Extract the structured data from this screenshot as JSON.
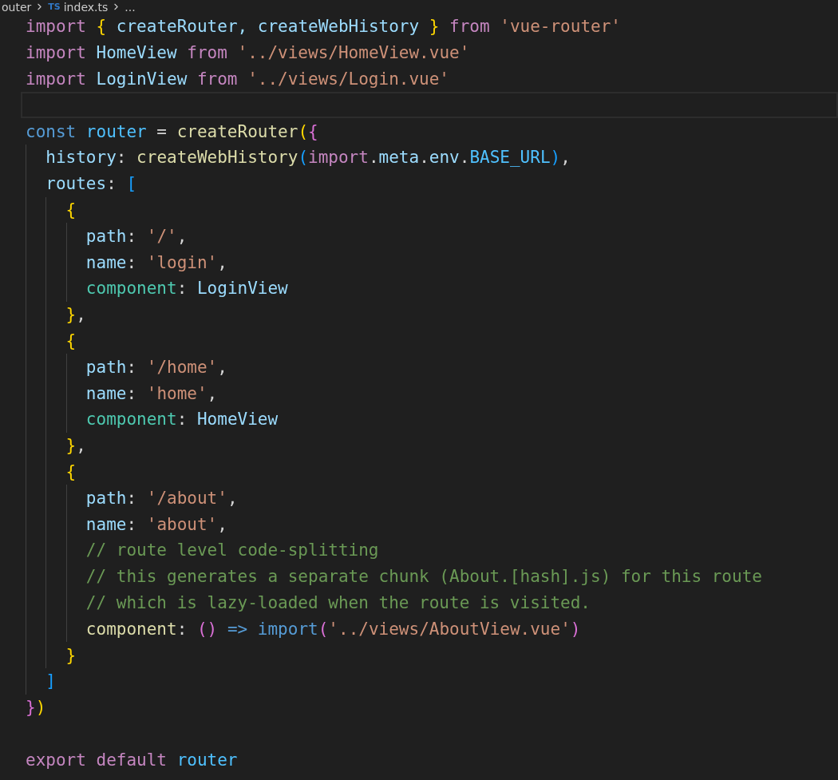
{
  "breadcrumb": {
    "folder": "outer",
    "file_badge": "TS",
    "file": "index.ts",
    "more": "..."
  },
  "lines": [
    {
      "active": false,
      "tokens": [
        {
          "text": "import ",
          "kind": "keyword"
        },
        {
          "text": "{",
          "kind": "bracket1"
        },
        {
          "text": " createRouter, createWebHistory ",
          "kind": "variable"
        },
        {
          "text": "}",
          "kind": "bracket1"
        },
        {
          "text": " from ",
          "kind": "keyword"
        },
        {
          "text": "'vue-router'",
          "kind": "string"
        }
      ]
    },
    {
      "active": false,
      "tokens": [
        {
          "text": "import",
          "kind": "keyword"
        },
        {
          "text": " HomeView ",
          "kind": "variable"
        },
        {
          "text": "from ",
          "kind": "keyword"
        },
        {
          "text": "'../views/HomeView.vue'",
          "kind": "string"
        }
      ]
    },
    {
      "active": false,
      "tokens": [
        {
          "text": "import",
          "kind": "keyword"
        },
        {
          "text": " LoginView ",
          "kind": "variable"
        },
        {
          "text": "from ",
          "kind": "keyword"
        },
        {
          "text": "'../views/Login.vue'",
          "kind": "string"
        }
      ]
    },
    {
      "active": true
    },
    {
      "active": false,
      "tokens": [
        {
          "text": "const ",
          "kind": "storage"
        },
        {
          "text": "router",
          "kind": "constant"
        },
        {
          "text": " = ",
          "kind": "punctuation"
        },
        {
          "text": "createRouter",
          "kind": "function"
        },
        {
          "text": "(",
          "kind": "bracket1"
        },
        {
          "text": "{",
          "kind": "bracket2"
        }
      ]
    },
    {
      "active": false,
      "tokens": [
        {
          "text": "  history",
          "kind": "variable"
        },
        {
          "text": ": ",
          "kind": "punctuation"
        },
        {
          "text": "createWebHistory",
          "kind": "function"
        },
        {
          "text": "(",
          "kind": "bracket3"
        },
        {
          "text": "import",
          "kind": "keyword"
        },
        {
          "text": ".",
          "kind": "punctuation"
        },
        {
          "text": "meta",
          "kind": "variable"
        },
        {
          "text": ".",
          "kind": "punctuation"
        },
        {
          "text": "env",
          "kind": "variable"
        },
        {
          "text": ".",
          "kind": "punctuation"
        },
        {
          "text": "BASE_URL",
          "kind": "constant"
        },
        {
          "text": ")",
          "kind": "bracket3"
        },
        {
          "text": ",",
          "kind": "punctuation"
        }
      ]
    },
    {
      "active": false,
      "tokens": [
        {
          "text": "  routes",
          "kind": "variable"
        },
        {
          "text": ": ",
          "kind": "punctuation"
        },
        {
          "text": "[",
          "kind": "bracket3"
        }
      ]
    },
    {
      "active": false,
      "tokens": [
        {
          "text": "    {",
          "kind": "bracket1"
        }
      ]
    },
    {
      "active": false,
      "tokens": [
        {
          "text": "      path",
          "kind": "variable"
        },
        {
          "text": ": ",
          "kind": "punctuation"
        },
        {
          "text": "'/'",
          "kind": "string"
        },
        {
          "text": ",",
          "kind": "punctuation"
        }
      ]
    },
    {
      "active": false,
      "tokens": [
        {
          "text": "      name",
          "kind": "variable"
        },
        {
          "text": ": ",
          "kind": "punctuation"
        },
        {
          "text": "'login'",
          "kind": "string"
        },
        {
          "text": ",",
          "kind": "punctuation"
        }
      ]
    },
    {
      "active": false,
      "tokens": [
        {
          "text": "      component",
          "kind": "type"
        },
        {
          "text": ": ",
          "kind": "punctuation"
        },
        {
          "text": "LoginView",
          "kind": "variable"
        }
      ]
    },
    {
      "active": false,
      "tokens": [
        {
          "text": "    }",
          "kind": "bracket1"
        },
        {
          "text": ",",
          "kind": "punctuation"
        }
      ]
    },
    {
      "active": false,
      "tokens": [
        {
          "text": "    {",
          "kind": "bracket1"
        }
      ]
    },
    {
      "active": false,
      "tokens": [
        {
          "text": "      path",
          "kind": "variable"
        },
        {
          "text": ": ",
          "kind": "punctuation"
        },
        {
          "text": "'/home'",
          "kind": "string"
        },
        {
          "text": ",",
          "kind": "punctuation"
        }
      ]
    },
    {
      "active": false,
      "tokens": [
        {
          "text": "      name",
          "kind": "variable"
        },
        {
          "text": ": ",
          "kind": "punctuation"
        },
        {
          "text": "'home'",
          "kind": "string"
        },
        {
          "text": ",",
          "kind": "punctuation"
        }
      ]
    },
    {
      "active": false,
      "tokens": [
        {
          "text": "      component",
          "kind": "type"
        },
        {
          "text": ": ",
          "kind": "punctuation"
        },
        {
          "text": "HomeView",
          "kind": "variable"
        }
      ]
    },
    {
      "active": false,
      "tokens": [
        {
          "text": "    }",
          "kind": "bracket1"
        },
        {
          "text": ",",
          "kind": "punctuation"
        }
      ]
    },
    {
      "active": false,
      "tokens": [
        {
          "text": "    {",
          "kind": "bracket1"
        }
      ]
    },
    {
      "active": false,
      "tokens": [
        {
          "text": "      path",
          "kind": "variable"
        },
        {
          "text": ": ",
          "kind": "punctuation"
        },
        {
          "text": "'/about'",
          "kind": "string"
        },
        {
          "text": ",",
          "kind": "punctuation"
        }
      ]
    },
    {
      "active": false,
      "tokens": [
        {
          "text": "      name",
          "kind": "variable"
        },
        {
          "text": ": ",
          "kind": "punctuation"
        },
        {
          "text": "'about'",
          "kind": "string"
        },
        {
          "text": ",",
          "kind": "punctuation"
        }
      ]
    },
    {
      "active": false,
      "tokens": [
        {
          "text": "      // route level code-splitting",
          "kind": "comment"
        }
      ]
    },
    {
      "active": false,
      "tokens": [
        {
          "text": "      // this generates a separate chunk (About.[hash].js) for this route",
          "kind": "comment"
        }
      ]
    },
    {
      "active": false,
      "tokens": [
        {
          "text": "      // which is lazy-loaded when the route is visited.",
          "kind": "comment"
        }
      ]
    },
    {
      "active": false,
      "tokens": [
        {
          "text": "      component",
          "kind": "function"
        },
        {
          "text": ": ",
          "kind": "punctuation"
        },
        {
          "text": "()",
          "kind": "bracket2"
        },
        {
          "text": " => import",
          "kind": "storage"
        },
        {
          "text": "(",
          "kind": "bracket2"
        },
        {
          "text": "'../views/AboutView.vue'",
          "kind": "string"
        },
        {
          "text": ")",
          "kind": "bracket2"
        }
      ]
    },
    {
      "active": false,
      "tokens": [
        {
          "text": "    }",
          "kind": "bracket1"
        }
      ]
    },
    {
      "active": false,
      "tokens": [
        {
          "text": "  ]",
          "kind": "bracket3"
        }
      ]
    },
    {
      "active": false,
      "tokens": [
        {
          "text": "}",
          "kind": "bracket2"
        },
        {
          "text": ")",
          "kind": "bracket1"
        }
      ]
    },
    {
      "active": false
    },
    {
      "active": false,
      "tokens": [
        {
          "text": "export default ",
          "kind": "keyword"
        },
        {
          "text": "router",
          "kind": "constant"
        }
      ]
    }
  ]
}
